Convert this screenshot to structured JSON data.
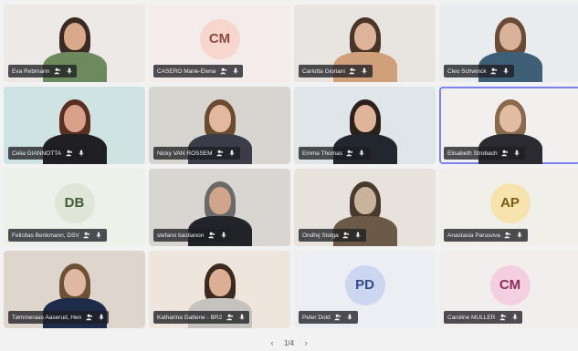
{
  "tiles": [
    {
      "name": "Eva Rebmann",
      "type": "video",
      "bg": "#ece9e6",
      "skin": "#d9a98c",
      "hair": "#3b2a22",
      "shirt": "#6c8a5e"
    },
    {
      "name": "CASERO Marie-Elena",
      "type": "avatar",
      "initials": "CM",
      "bg": "#f3ecea",
      "avatar_bg": "#f7d6ce",
      "avatar_fg": "#8a4a3c"
    },
    {
      "name": "Carlotta Gioriani",
      "type": "video",
      "bg": "#e8e4df",
      "skin": "#dfb39a",
      "hair": "#4a3427",
      "shirt": "#cfa07a"
    },
    {
      "name": "Cleo Schwinck",
      "type": "video",
      "bg": "#e9ecee",
      "skin": "#d8b29b",
      "hair": "#6b4a35",
      "shirt": "#3f5f76"
    },
    {
      "name": "Celia GIANNOTTA",
      "type": "video",
      "bg": "#cfe3e2",
      "skin": "#d7a18a",
      "hair": "#5a2f22",
      "shirt": "#1f1f24"
    },
    {
      "name": "Nicky VAN ROSSEM",
      "type": "video",
      "bg": "#d8d4cf",
      "skin": "#e2b9a0",
      "hair": "#6b4a32",
      "shirt": "#3a3d48"
    },
    {
      "name": "Emma Thomas",
      "type": "video",
      "bg": "#dfe6ea",
      "skin": "#e0b49b",
      "hair": "#2b201b",
      "shirt": "#22262d"
    },
    {
      "name": "Elisabeth Strobach",
      "type": "video",
      "bg": "#f1f0ee",
      "skin": "#e3bca4",
      "hair": "#8a6a4c",
      "shirt": "#2a2a30",
      "active": true
    },
    {
      "name": "Felicitas Benkmann, DSV",
      "type": "avatar",
      "initials": "DB",
      "bg": "#eef0ea",
      "avatar_bg": "#dfe6d8",
      "avatar_fg": "#3e5b3a"
    },
    {
      "name": "stefano bastianon",
      "type": "video",
      "bg": "#d9d6d1",
      "skin": "#d1a58c",
      "hair": "#6a6a6a",
      "shirt": "#23242a"
    },
    {
      "name": "Ondřej Štolga",
      "type": "video",
      "bg": "#e7e3dc",
      "skin": "#c9b39c",
      "hair": "#4a3a2e",
      "shirt": "#6b5a48"
    },
    {
      "name": "Anastasia Parusova",
      "type": "avatar",
      "initials": "AP",
      "bg": "#f1efe9",
      "avatar_bg": "#f6e3ad",
      "avatar_fg": "#7a5a12"
    },
    {
      "name": "Tømmeraas Aaserud, Hen",
      "type": "video",
      "bg": "#ded6cc",
      "skin": "#e0b7a0",
      "hair": "#6b5236",
      "shirt": "#1f2b4a"
    },
    {
      "name": "Katharina Gattene - BR2",
      "type": "video",
      "bg": "#eee6dc",
      "skin": "#dcae93",
      "hair": "#3c2a20",
      "shirt": "#c6c2be"
    },
    {
      "name": "Peter Dold",
      "type": "avatar",
      "initials": "PD",
      "bg": "#edeef3",
      "avatar_bg": "#cdd6f0",
      "avatar_fg": "#2f4a8a"
    },
    {
      "name": "Caroline MULLER",
      "type": "avatar",
      "initials": "CM",
      "bg": "#f3eeee",
      "avatar_bg": "#f3cfe0",
      "avatar_fg": "#8a2f5a"
    }
  ],
  "pager": {
    "prev": "‹",
    "text": "1/4",
    "next": "›"
  },
  "icons": {
    "participant": "people-icon",
    "mic": "mic-icon"
  }
}
